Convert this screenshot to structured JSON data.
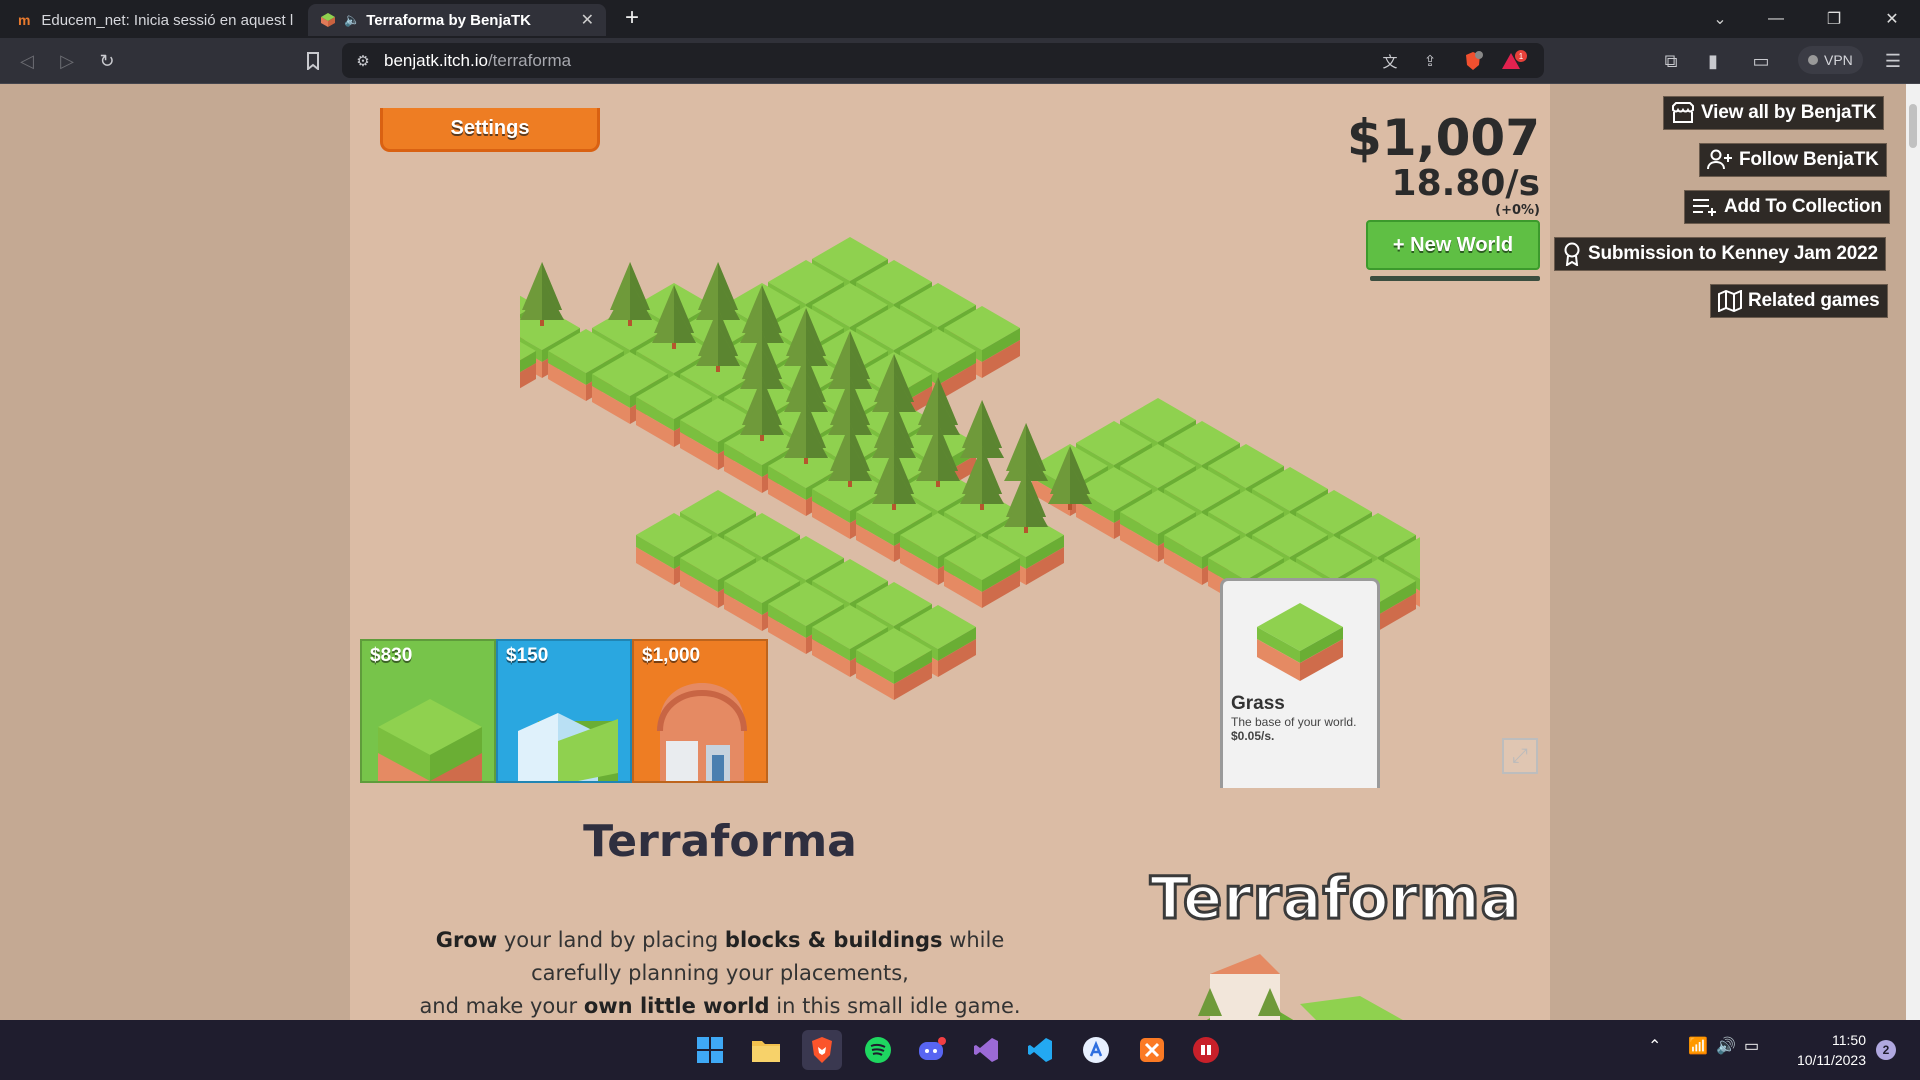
{
  "browser": {
    "tabs": [
      {
        "title": "Educem_net: Inicia sessió en aquest llo",
        "active": false
      },
      {
        "title": "Terraforma by BenjaTK",
        "active": true
      }
    ],
    "url_host": "benjatk.itch.io",
    "url_path": "/terraforma",
    "vpn_label": "VPN",
    "brave_badge": "1",
    "alert_badge": "1"
  },
  "game": {
    "settings_label": "Settings",
    "money": "$1,007",
    "rate": "18.80/s",
    "rate_bonus": "(+0%)",
    "new_world_label": "+ New World",
    "shop": [
      {
        "price": "$830",
        "color": "#77c44a",
        "item": "grass-block"
      },
      {
        "price": "$150",
        "color": "#2aa7e0",
        "item": "water-block"
      },
      {
        "price": "$1,000",
        "color": "#ee7d23",
        "item": "house-building"
      }
    ],
    "selected": {
      "name": "Grass",
      "description": "The base of your world.",
      "rate": "$0.05/s."
    }
  },
  "itch": {
    "buttons": {
      "view_all": "View all by BenjaTK",
      "follow": "Follow BenjaTK",
      "collection": "Add To Collection",
      "jam": "Submission to Kenney Jam 2022",
      "related": "Related games"
    },
    "title": "Terraforma",
    "logo_text": "Terraforma",
    "desc": {
      "grow": "Grow",
      "t1": " your land by placing ",
      "blocks": "blocks & buildings",
      "t2": " while",
      "line2": "carefully planning your placements,",
      "t3": "and make your ",
      "own": "own little world",
      "t4": " in this small idle game."
    }
  },
  "taskbar": {
    "time": "11:50",
    "date": "10/11/2023",
    "notifications": "2"
  },
  "colors": {
    "page_bg": "#c4a993",
    "game_bg": "#dbbca5",
    "grass_top": "#8fd14f",
    "dirt": "#e07a58",
    "tree": "#6f9a3a"
  }
}
